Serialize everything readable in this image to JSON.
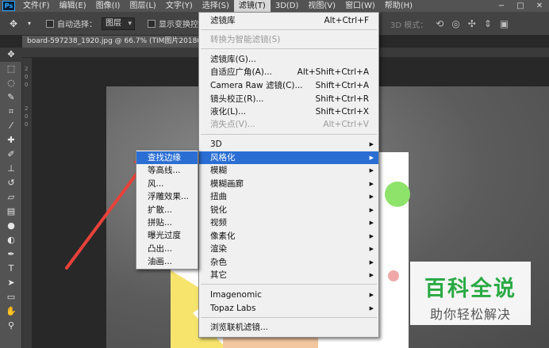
{
  "app": {
    "logo": "Ps"
  },
  "menubar": {
    "items": [
      {
        "label": "文件(F)"
      },
      {
        "label": "编辑(E)"
      },
      {
        "label": "图像(I)"
      },
      {
        "label": "图层(L)"
      },
      {
        "label": "文字(Y)"
      },
      {
        "label": "选择(S)"
      },
      {
        "label": "滤镜(T)"
      },
      {
        "label": "3D(D)"
      },
      {
        "label": "视图(V)"
      },
      {
        "label": "窗口(W)"
      },
      {
        "label": "帮助(H)"
      }
    ]
  },
  "window_controls": {
    "minimize": "−",
    "restore": "□",
    "close": "✕"
  },
  "options": {
    "auto_select_label": "自动选择：",
    "auto_select_value": "图层",
    "transform_label": "显示变换控件",
    "mode_3d": "3D 模式："
  },
  "document": {
    "tab_title": "board-597238_1920.jpg @ 66.7% (TIM图片20180127125",
    "ruler_left_ticks": [
      "2",
      "0",
      "0",
      "2",
      "0",
      "0"
    ]
  },
  "filter_menu": {
    "items": [
      {
        "label": "滤镜库",
        "shortcut": "Alt+Ctrl+F"
      },
      {
        "label": "转换为智能滤镜(S)",
        "disabled": true
      },
      {
        "label": "滤镜库(G)..."
      },
      {
        "label": "自适应广角(A)...",
        "shortcut": "Alt+Shift+Ctrl+A"
      },
      {
        "label": "Camera Raw 滤镜(C)...",
        "shortcut": "Shift+Ctrl+A"
      },
      {
        "label": "镜头校正(R)...",
        "shortcut": "Shift+Ctrl+R"
      },
      {
        "label": "液化(L)...",
        "shortcut": "Shift+Ctrl+X"
      },
      {
        "label": "消失点(V)...",
        "shortcut": "Alt+Ctrl+V",
        "disabled": true
      },
      {
        "label": "3D"
      },
      {
        "label": "风格化"
      },
      {
        "label": "模糊"
      },
      {
        "label": "模糊画廊"
      },
      {
        "label": "扭曲"
      },
      {
        "label": "锐化"
      },
      {
        "label": "视频"
      },
      {
        "label": "像素化"
      },
      {
        "label": "渲染"
      },
      {
        "label": "杂色"
      },
      {
        "label": "其它"
      },
      {
        "label": "Imagenomic"
      },
      {
        "label": "Topaz Labs"
      },
      {
        "label": "浏览联机滤镜..."
      }
    ],
    "submenu_arrow": "▶"
  },
  "stylize_submenu": {
    "items": [
      {
        "label": "查找边缘"
      },
      {
        "label": "等高线..."
      },
      {
        "label": "风..."
      },
      {
        "label": "浮雕效果..."
      },
      {
        "label": "扩散..."
      },
      {
        "label": "拼贴..."
      },
      {
        "label": "曝光过度"
      },
      {
        "label": "凸出..."
      },
      {
        "label": "油画..."
      }
    ]
  },
  "watermark": {
    "title": "百科全说",
    "subtitle": "助你轻松解决"
  },
  "colors": {
    "highlight": "#2a6ed3",
    "arrow": "#e8413a",
    "watermark_green": "#2aa944"
  }
}
